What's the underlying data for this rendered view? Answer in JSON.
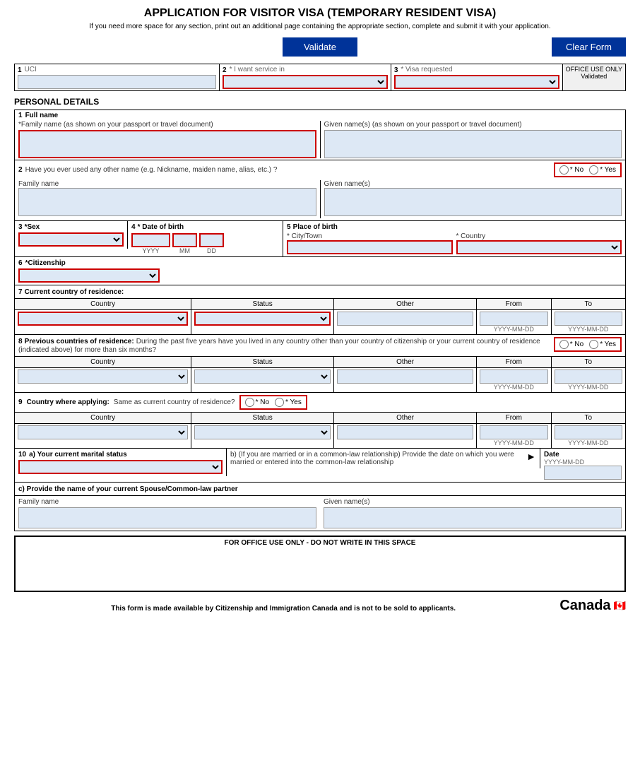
{
  "page": {
    "title": "APPLICATION FOR VISITOR VISA (TEMPORARY RESIDENT VISA)",
    "subtitle": "If you need more space for any section, print out an additional page containing the appropriate section, complete and submit it with your application.",
    "validate_btn": "Validate",
    "clear_btn": "Clear Form",
    "office_use_label": "OFFICE USE ONLY",
    "office_use_status": "Validated",
    "for_office_footer": "FOR OFFICE USE ONLY - DO NOT WRITE IN THIS SPACE",
    "footer_note": "This form is made available by Citizenship and Immigration Canada and is not to be sold to applicants."
  },
  "top_fields": {
    "field1_num": "1",
    "field1_label": "UCI",
    "field2_num": "2",
    "field2_label": "* I want service in",
    "field3_num": "3",
    "field3_label": "* Visa requested"
  },
  "personal_details": {
    "header": "PERSONAL DETAILS",
    "row1_num": "1",
    "row1_label": "Full name",
    "family_name_label": "*Family name  (as shown on your passport or travel document)",
    "given_names_label": "Given name(s)  (as shown on your passport or travel document)",
    "row2_num": "2",
    "row2_label": "Have you ever used any other name (e.g. Nickname, maiden name, alias, etc.) ?",
    "row2_no": "* No",
    "row2_yes": "* Yes",
    "family_name_alt_label": "Family name",
    "given_names_alt_label": "Given name(s)",
    "row3_num": "3",
    "row3_sex_label": "*Sex",
    "row4_num": "4",
    "row4_dob_label": "* Date of birth",
    "dob_yyyy": "YYYY",
    "dob_mm": "MM",
    "dob_dd": "DD",
    "row5_num": "5",
    "row5_pob_label": "Place of birth",
    "city_label": "* City/Town",
    "country_label": "* Country",
    "row6_num": "6",
    "row6_citizenship_label": "*Citizenship",
    "row7_num": "7",
    "row7_label": "Current country of residence:",
    "col_country": "Country",
    "col_status": "Status",
    "col_other": "Other",
    "col_from": "From",
    "col_to": "To",
    "date_hint": "YYYY-MM-DD",
    "row8_num": "8",
    "row8_label": "Previous countries of residence:",
    "row8_desc": "During the past five years have you lived in any country other than your country of citizenship or your current country of residence (indicated above) for more than six months?",
    "row8_no": "* No",
    "row8_yes": "* Yes",
    "row9_num": "9",
    "row9_label": "Country where applying:",
    "row9_desc": "Same as current country of residence?",
    "row9_no": "* No",
    "row9_yes": "* Yes",
    "row10_num": "10",
    "row10a_label": "a) Your current marital status",
    "row10b_label": "b) (If you are married or in a common-law relationship) Provide the date on which you were married or entered into the common-law relationship",
    "date_label": "Date",
    "row10c_label": "c) Provide the name of your current Spouse/Common-law partner",
    "spouse_family_label": "Family name",
    "spouse_given_label": "Given name(s)"
  }
}
